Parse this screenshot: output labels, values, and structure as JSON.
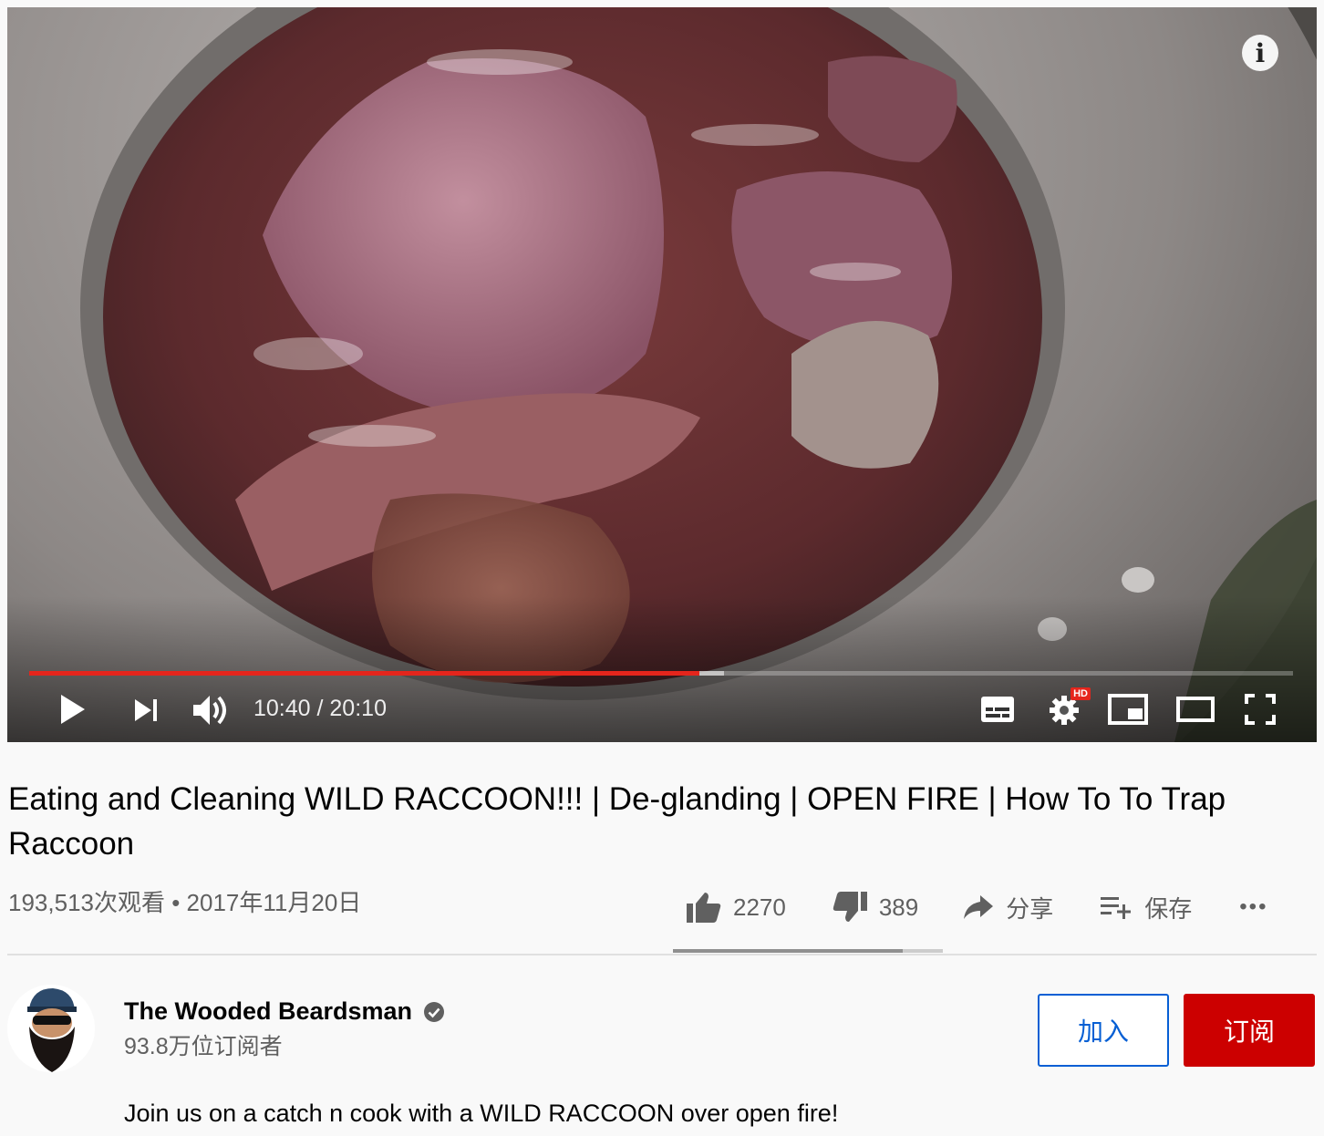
{
  "player": {
    "time_current": "10:40",
    "time_separator": " / ",
    "time_total": "20:10",
    "progress_fraction": 0.53,
    "buffered_fraction": 0.55,
    "hd_badge": "HD",
    "info_glyph": "i",
    "accent_color": "#e5251c",
    "icons": [
      "play-icon",
      "next-icon",
      "volume-icon",
      "subtitles-icon",
      "settings-icon",
      "miniplayer-icon",
      "theater-mode-icon",
      "fullscreen-icon",
      "info-icon"
    ]
  },
  "video": {
    "title": "Eating and Cleaning WILD RACCOON!!! | De-glanding | OPEN FIRE | How To To Trap Raccoon",
    "views": "193,513次观看",
    "meta_separator": " • ",
    "date": "2017年11月20日"
  },
  "actions": {
    "likes": "2270",
    "dislikes": "389",
    "share_label": "分享",
    "save_label": "保存",
    "more_label": "•••",
    "like_fraction": 0.85
  },
  "channel": {
    "name": "The Wooded Beardsman",
    "subscribers": "93.8万位订阅者",
    "join_label": "加入",
    "subscribe_label": "订阅",
    "subscribe_color": "#cc0000",
    "join_color": "#065fd4"
  },
  "description": {
    "text": "Join us on a catch n cook with a WILD RACCOON over open fire!"
  }
}
